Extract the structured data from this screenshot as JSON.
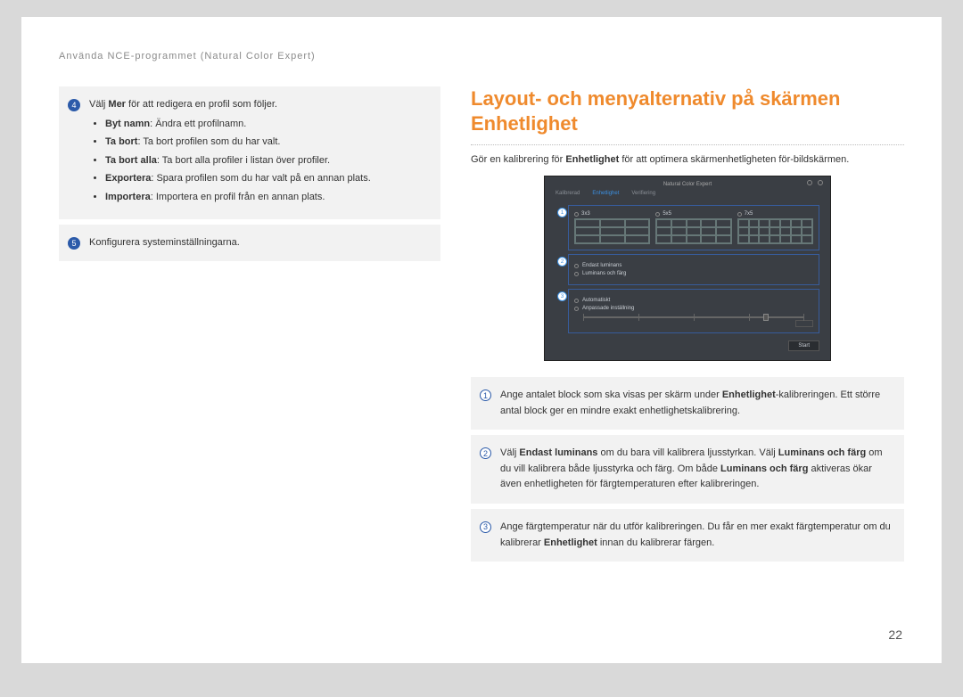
{
  "breadcrumb": "Använda NCE-programmet (Natural Color Expert)",
  "left": {
    "step4_lead": {
      "pre": "Välj ",
      "bold": "Mer",
      "post": " för att redigera en profil som följer."
    },
    "items": [
      {
        "t": "Byt namn",
        "d": ": Ändra ett profilnamn."
      },
      {
        "t": "Ta bort",
        "d": ": Ta bort profilen som du har valt."
      },
      {
        "t": "Ta bort alla",
        "d": ": Ta bort alla profiler i listan över profiler."
      },
      {
        "t": "Exportera",
        "d": ": Spara profilen som du har valt på en annan plats."
      },
      {
        "t": "Importera",
        "d": ": Importera en profil från en annan plats."
      }
    ],
    "step5": "Konfigurera systeminställningarna."
  },
  "right": {
    "heading": "Layout- och menyalternativ på skärmen Enhetlighet",
    "intro": {
      "pre": "Gör en kalibrering för ",
      "bold": "Enhetlighet",
      "post": " för att optimera skärmenhetligheten för-bildskärmen."
    },
    "scr": {
      "title": "Natural Color Expert",
      "tabs": [
        "Kalibrerad",
        "Enhetlighet",
        "Verifiering"
      ],
      "grids": [
        "3x3",
        "5x5",
        "7x5"
      ],
      "opts2": [
        "Endast luminans",
        "Luminans och färg"
      ],
      "opts3": [
        "Automatiskt",
        "Anpassade inställning"
      ],
      "start": "Start"
    },
    "notes": [
      {
        "n": "1",
        "segs": [
          {
            "t": "Ange antalet block som ska visas per skärm under "
          },
          {
            "t": "Enhetlighet",
            "b": 1
          },
          {
            "t": "-kalibreringen. Ett större antal block ger en mindre exakt enhetlighetskalibrering."
          }
        ]
      },
      {
        "n": "2",
        "segs": [
          {
            "t": "Välj "
          },
          {
            "t": "Endast luminans",
            "b": 1
          },
          {
            "t": " om du bara vill kalibrera ljusstyrkan. Välj "
          },
          {
            "t": "Luminans och färg",
            "b": 1
          },
          {
            "t": " om du vill kalibrera både ljusstyrka och färg. Om både "
          },
          {
            "t": "Luminans och färg",
            "b": 1
          },
          {
            "t": " aktiveras ökar även enhetligheten för färgtemperaturen efter kalibreringen."
          }
        ]
      },
      {
        "n": "3",
        "segs": [
          {
            "t": "Ange färgtemperatur när du utför kalibreringen. Du får en mer exakt färgtemperatur om du kalibrerar "
          },
          {
            "t": "Enhetlighet",
            "b": 1
          },
          {
            "t": " innan du kalibrerar färgen."
          }
        ]
      }
    ]
  },
  "pageno": "22"
}
